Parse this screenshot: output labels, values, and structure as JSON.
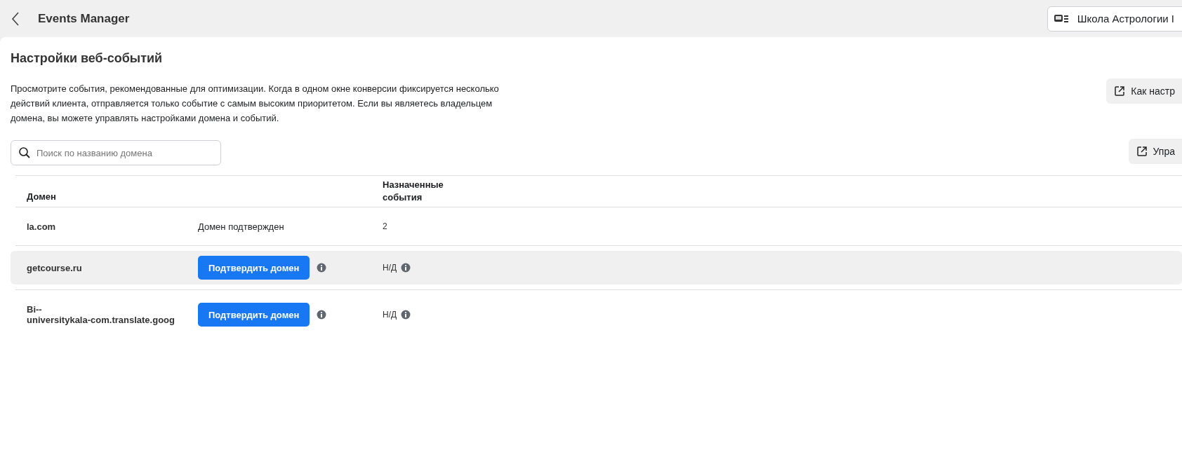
{
  "header": {
    "title": "Events Manager",
    "account": "Школа Астрологии I"
  },
  "page": {
    "title": "Настройки веб-событий",
    "description": "Просмотрите события, рекомендованные для оптимизации. Когда в одном окне конверсии фиксируется несколько действий клиента, отправляется только событие с самым высоким приоритетом. Если вы являетесь владельцем домена, вы можете управлять настройками домена и событий.",
    "help_link": "Как настр",
    "search": {
      "placeholder": "Поиск по названию домена"
    },
    "manage_link": "Упра"
  },
  "table": {
    "columns": [
      "Домен",
      "Назначенные события"
    ],
    "rows": [
      {
        "domain": [
          "la.com"
        ],
        "status": {
          "kind": "text",
          "text": "Домен подтвержден"
        },
        "events": "2",
        "events_info": false,
        "selected": false
      },
      {
        "domain": [
          "getcourse.ru"
        ],
        "status": {
          "kind": "button",
          "text": "Подтвердить домен"
        },
        "events": "Н/Д",
        "events_info": true,
        "selected": true
      },
      {
        "domain": [
          "Bi--",
          "universitykala-com.translate.goog"
        ],
        "status": {
          "kind": "button",
          "text": "Подтвердить домен"
        },
        "events": "Н/Д",
        "events_info": true,
        "selected": false
      }
    ]
  }
}
